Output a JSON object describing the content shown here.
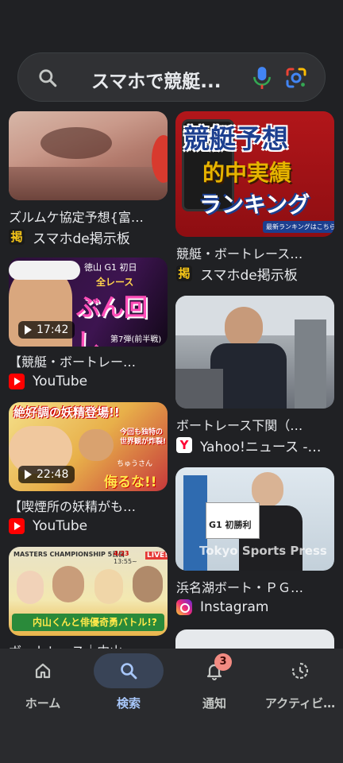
{
  "search": {
    "query": "スマホで競艇...",
    "colors": {
      "mic_top": "#4285f4",
      "mic_base": "#ea4335"
    }
  },
  "results_left": [
    {
      "title": "ズルムケ協定予想{富…",
      "source": "スマホde掲示板",
      "source_icon": "keijiban-icon",
      "duration": ""
    },
    {
      "title": "【競艇・ボートレー…",
      "source": "YouTube",
      "source_icon": "youtube-icon",
      "duration": "17:42",
      "thumb_text": [
        "徳山 G1 初日",
        "全レース",
        "ぶん回し",
        "第7弾(前半戦)"
      ]
    },
    {
      "title": "【喫煙所の妖精がも…",
      "source": "YouTube",
      "source_icon": "youtube-icon",
      "duration": "22:48",
      "thumb_text": [
        "絶好調の妖精登場!!",
        "今回も独特の",
        "世界観が炸裂!",
        "ちゅうさん",
        "侮るな!!"
      ]
    },
    {
      "title": "ボートレース｜内山…",
      "thumb_text": [
        "MASTERS CHAMPIONSHIP 5日目",
        "4/23",
        "13:55~",
        "LIVE!",
        "内山くんと俳優奇勇バトル!?"
      ]
    }
  ],
  "results_right": [
    {
      "title": "競艇・ボートレース…",
      "source": "スマホde掲示板",
      "source_icon": "keijiban-icon",
      "thumb_text": [
        "競艇予想",
        "的中実績",
        "ランキング",
        "最新ランキングはこちら"
      ]
    },
    {
      "title": "ボートレース下関（…",
      "source": "Yahoo!ニュース -…",
      "source_icon": "yahoo-icon"
    },
    {
      "title": "浜名湖ボート・ＰＧ…",
      "source": "Instagram",
      "source_icon": "instagram-icon",
      "thumb_text": [
        "Tokyo Sports Press",
        "G1 初勝利"
      ]
    },
    {
      "title": ""
    }
  ],
  "nav": {
    "items": [
      {
        "label": "ホーム",
        "icon": "home-icon"
      },
      {
        "label": "検索",
        "icon": "search-icon",
        "active": true
      },
      {
        "label": "通知",
        "icon": "bell-icon",
        "badge": "3"
      },
      {
        "label": "アクティビ…",
        "icon": "activity-icon"
      }
    ],
    "colors": {
      "active_pill": "#394457",
      "active_label": "#a8c7fa",
      "badge": "#f28b82"
    }
  }
}
